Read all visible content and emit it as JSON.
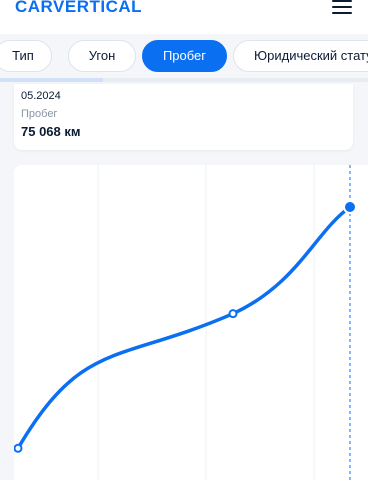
{
  "header": {
    "logo": "CARVERTICAL",
    "menu_icon": "hamburger-menu-icon"
  },
  "tabs": [
    {
      "label": "Тип",
      "active": false
    },
    {
      "label": "Угон",
      "active": false
    },
    {
      "label": "Пробег",
      "active": true
    },
    {
      "label": "Юридический статус",
      "active": false
    }
  ],
  "progress": {
    "fraction": 0.28
  },
  "detail_card": {
    "date": "05.2024",
    "label": "Пробег",
    "value": "75 068 км"
  },
  "colors": {
    "accent": "#0a6ff0",
    "background": "#f4f6f9"
  },
  "chart_data": {
    "type": "line",
    "title": "",
    "xlabel": "",
    "ylabel": "",
    "series": [
      {
        "values": [
          0.05,
          0.58,
          1.0
        ]
      }
    ],
    "highlighted_point": 2,
    "grid": true
  }
}
